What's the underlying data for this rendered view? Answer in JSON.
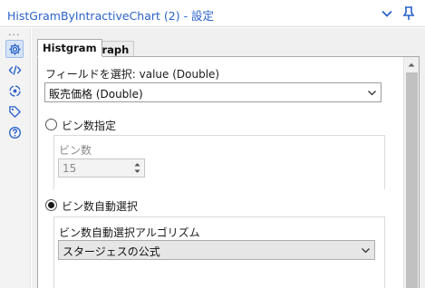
{
  "header": {
    "title": "HistGramByIntractiveChart (2) - 設定"
  },
  "rail": {
    "dots": "...",
    "icons": [
      "gear-icon",
      "code-icon",
      "target-icon",
      "tag-icon",
      "help-icon"
    ]
  },
  "tabs": [
    {
      "label": "Histgram",
      "active": true
    },
    {
      "label": "Graph",
      "active": false
    }
  ],
  "form": {
    "field_label": "フィールドを選択: value (Double)",
    "field_value": "販売価格 (Double)",
    "bin_count_radio_label": "ビン数指定",
    "bin_count_label": "ビン数",
    "bin_count_value": "15",
    "auto_bin_radio_label": "ビン数自動選択",
    "algorithm_label": "ビン数自動選択アルゴリズム",
    "algorithm_value": "スタージェスの公式",
    "selected_mode": "auto"
  },
  "colors": {
    "title": "#2a62c9",
    "icon": "#2a62c9"
  }
}
